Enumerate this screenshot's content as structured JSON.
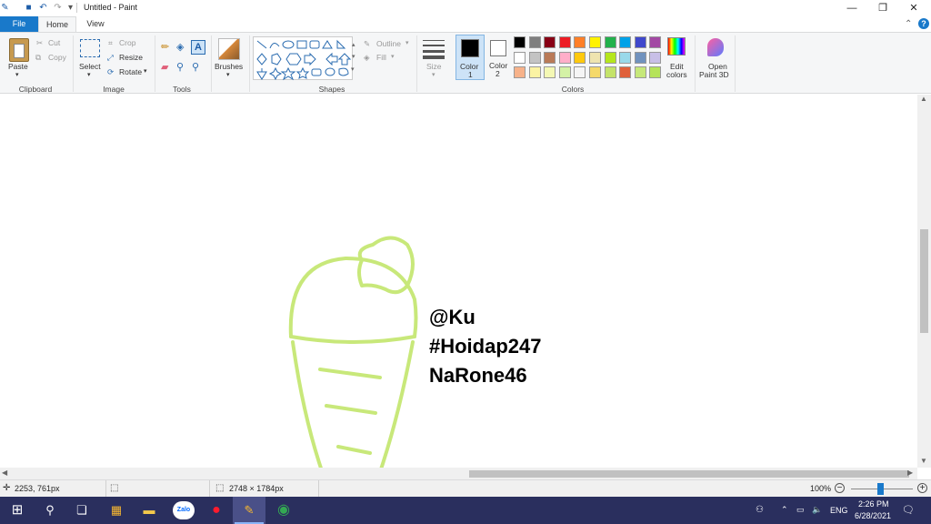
{
  "window": {
    "title": "Untitled - Paint"
  },
  "tabs": {
    "file": "File",
    "home": "Home",
    "view": "View"
  },
  "ribbon": {
    "clipboard": {
      "paste": "Paste",
      "cut": "Cut",
      "copy": "Copy",
      "label": "Clipboard"
    },
    "image": {
      "select": "Select",
      "crop": "Crop",
      "resize": "Resize",
      "rotate": "Rotate",
      "label": "Image"
    },
    "tools": {
      "label": "Tools"
    },
    "brushes": {
      "label": "Brushes"
    },
    "shapes": {
      "outline": "Outline",
      "fill": "Fill",
      "label": "Shapes"
    },
    "size": {
      "label": "Size"
    },
    "color1": {
      "label1": "Color",
      "label2": "1",
      "value": "#000000"
    },
    "color2": {
      "label1": "Color",
      "label2": "2",
      "value": "#ffffff"
    },
    "colors": {
      "label": "Colors",
      "edit1": "Edit",
      "edit2": "colors"
    },
    "paint3d": {
      "label1": "Open",
      "label2": "Paint 3D"
    },
    "palette_row1": [
      "#000000",
      "#7f7f7f",
      "#880015",
      "#ed1c24",
      "#ff7f27",
      "#fff200",
      "#22b14c",
      "#00a2e8",
      "#3f48cc",
      "#a349a4"
    ],
    "palette_row2": [
      "#ffffff",
      "#c3c3c3",
      "#b97a57",
      "#ffaec9",
      "#ffc90e",
      "#efe4b0",
      "#b5e61d",
      "#99d9ea",
      "#7092be",
      "#c8bfe7"
    ],
    "palette_row3": [
      "#f7b28a",
      "#fbf3a3",
      "#f4f8b4",
      "#d4f2a6",
      "#f5f5f5",
      "#f5d96a",
      "#c4e36a",
      "#e0603a",
      "#c6e87a",
      "#b5e35a"
    ]
  },
  "canvas": {
    "text_line1": "@Ku",
    "text_line2": "#Hoidap247",
    "text_line3": "NaRone46",
    "drawing_color": "#c8e87a"
  },
  "status": {
    "cursor_pos": "2253, 761px",
    "image_size": "2748 × 1784px",
    "zoom": "100%"
  },
  "taskbar": {
    "lang": "ENG",
    "time": "2:26 PM",
    "date": "6/28/2021",
    "zalo": "Zalo"
  }
}
